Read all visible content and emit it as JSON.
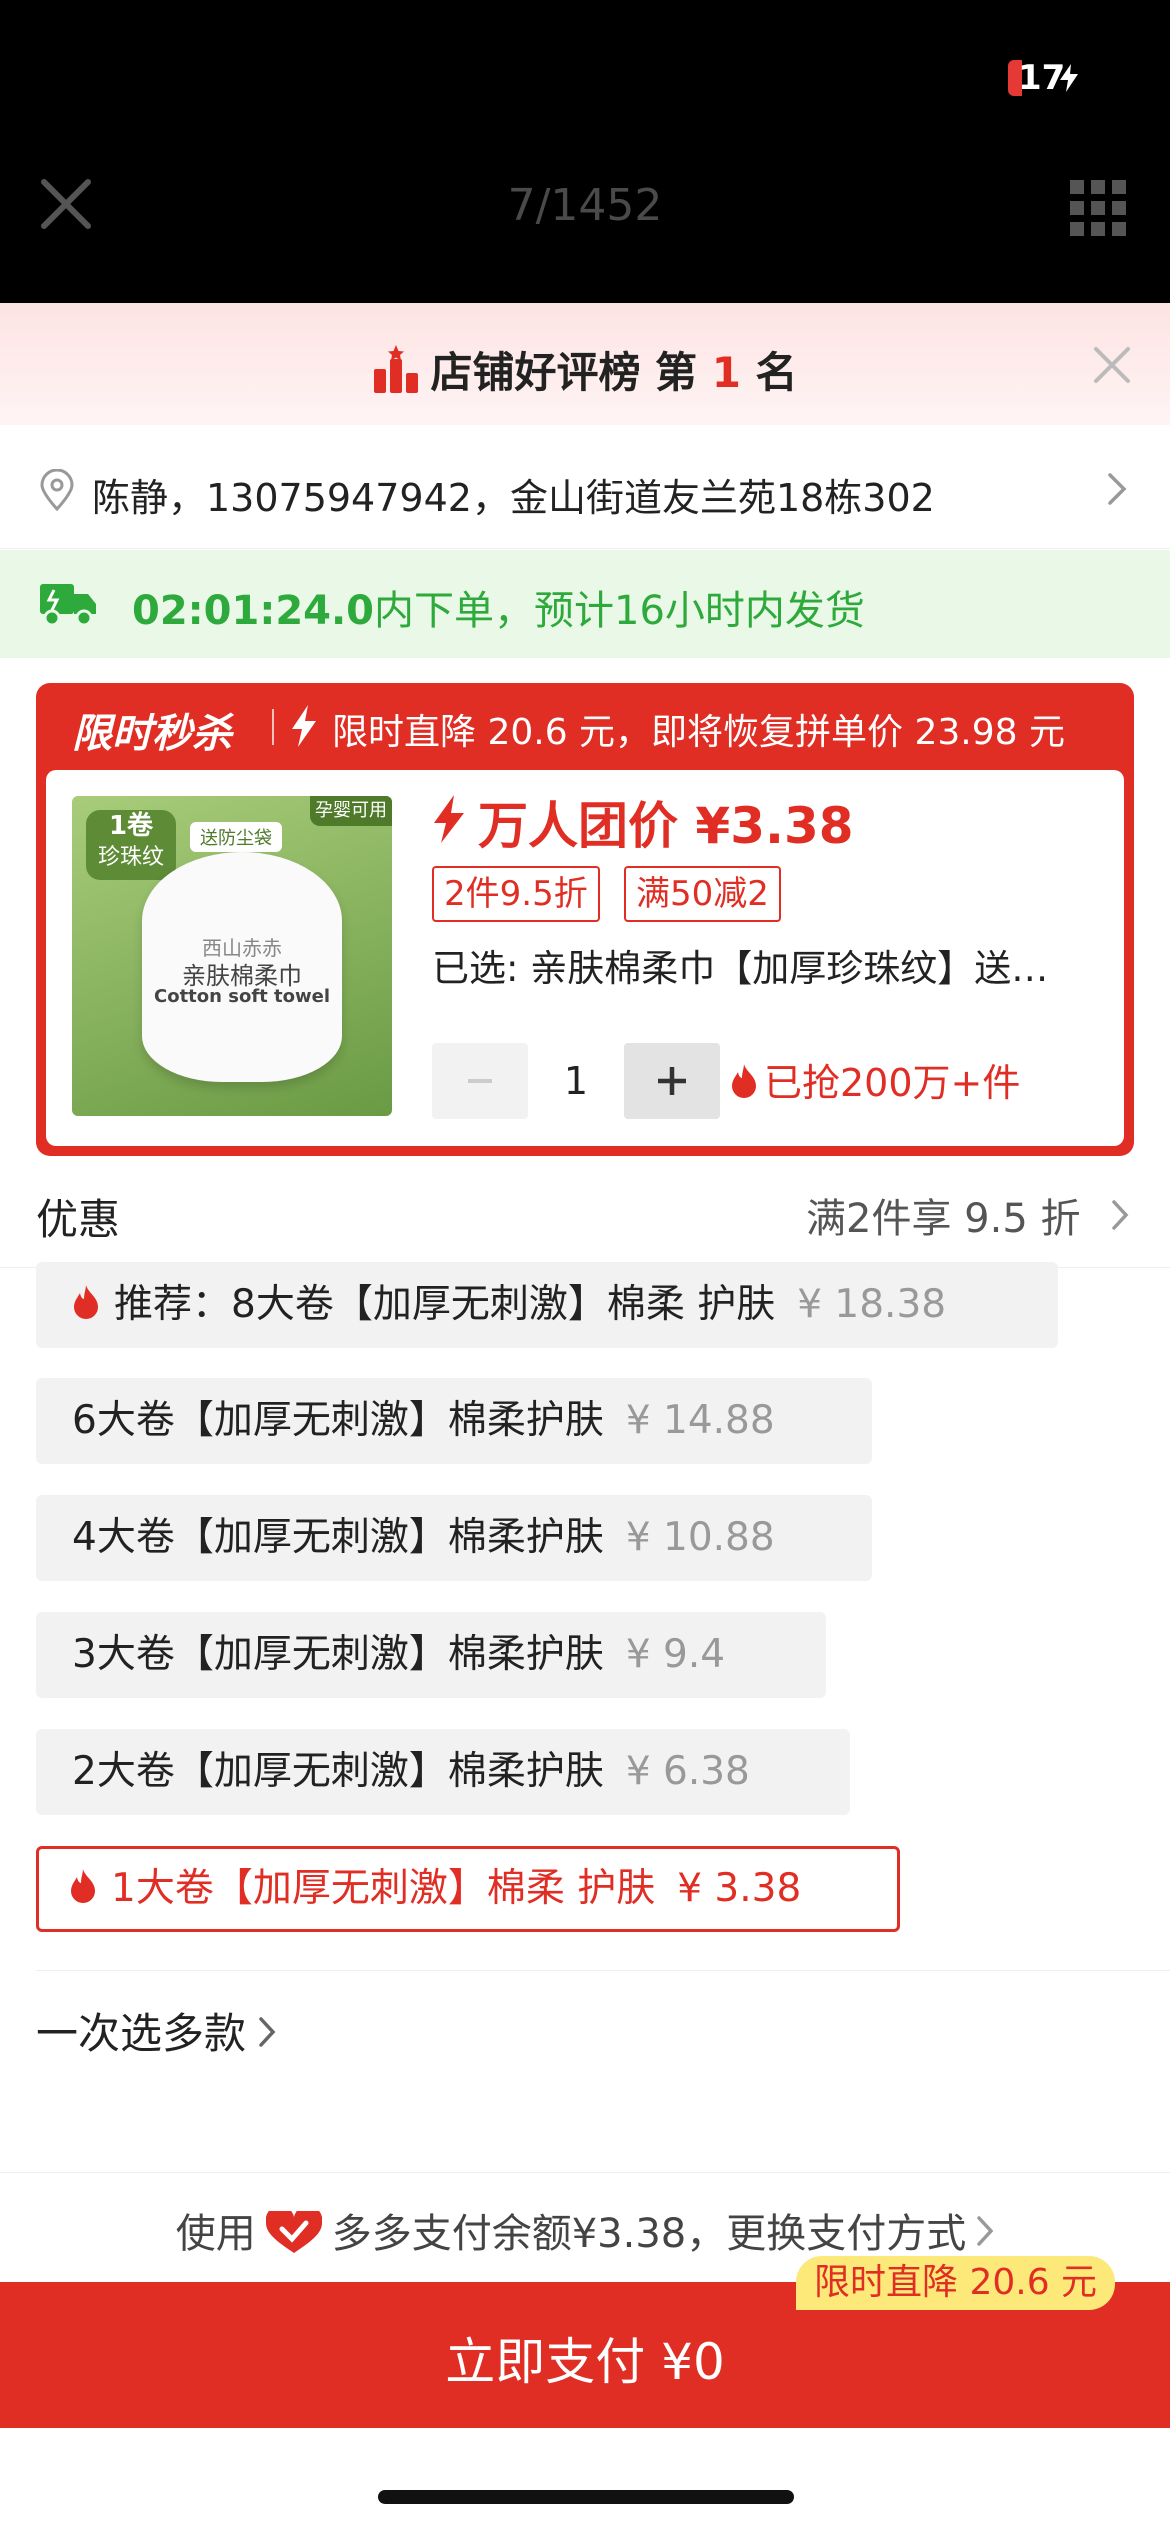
{
  "status_bar": {
    "battery": "17"
  },
  "nav": {
    "counter": "7/1452"
  },
  "rank": {
    "prefix": "店铺好评榜 第 ",
    "number": "1",
    "suffix": " 名"
  },
  "address": {
    "text": "陈静，13075947942，金山街道友兰苑18栋302"
  },
  "shipping": {
    "time": "02:01:24.0",
    "text": "内下单，预计16小时内发货"
  },
  "flash_sale": {
    "title": "限时秒杀",
    "desc": "限时直降 20.6 元，即将恢复拼单价 23.98 元"
  },
  "product": {
    "image": {
      "badge_top": "1卷",
      "badge_bottom": "珍珠纹",
      "corner_tag": "孕婴可用",
      "dust_tag": "送防尘袋",
      "bag_brand": "西山赤赤",
      "bag_name": "亲肤棉柔巾",
      "bag_en": "Cotton soft towel"
    },
    "group_price": "万人团价 ¥3.38",
    "tags": [
      "2件9.5折",
      "满50减2"
    ],
    "selected": "已选: 亲肤棉柔巾【加厚珍珠纹】送…",
    "quantity": "1",
    "minus": "−",
    "plus": "+",
    "sold": "已抢200万+件"
  },
  "discount": {
    "label": "优惠",
    "value": "满2件享 9.5 折"
  },
  "skus": [
    {
      "label": "推荐：8大卷【加厚无刺激】棉柔 护肤",
      "price": "¥ 18.38"
    },
    {
      "label": "6大卷【加厚无刺激】棉柔护肤",
      "price": "¥ 14.88"
    },
    {
      "label": "4大卷【加厚无刺激】棉柔护肤",
      "price": "¥ 10.88"
    },
    {
      "label": "3大卷【加厚无刺激】棉柔护肤",
      "price": "¥ 9.4"
    },
    {
      "label": "2大卷【加厚无刺激】棉柔护肤",
      "price": "¥ 6.38"
    },
    {
      "label": "1大卷【加厚无刺激】棉柔 护肤",
      "price": "¥ 3.38"
    }
  ],
  "multi_select": "一次选多款",
  "payment": {
    "use": "使用",
    "method": "多多支付余额¥3.38，更换支付方式",
    "badge": "限时直降 20.6 元",
    "button": "立即支付 ¥0"
  },
  "colors": {
    "accent": "#e02e24",
    "green": "#2eaa3c",
    "badge_yellow": "#fde97a"
  }
}
